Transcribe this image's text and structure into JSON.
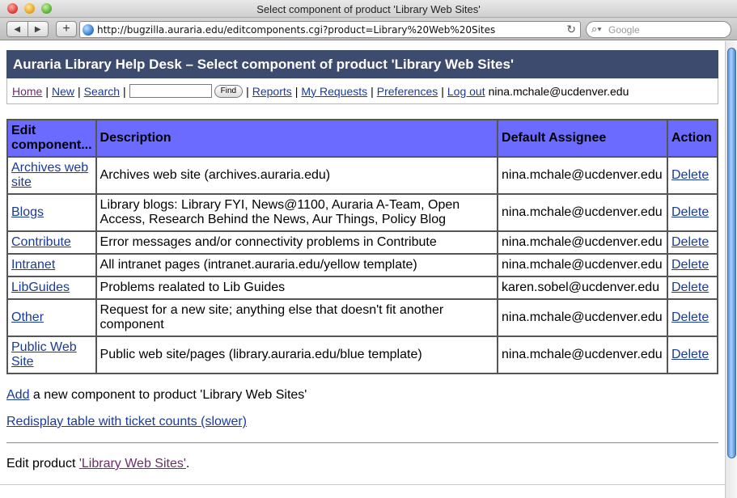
{
  "window": {
    "title": "Select component of product 'Library Web Sites'",
    "back_label": "◀",
    "forward_label": "▶",
    "add_label": "+",
    "url": "http://bugzilla.auraria.edu/editcomponents.cgi?product=Library%20Web%20Sites",
    "reload_glyph": "↻",
    "search_glyph": "⌕▾",
    "search_placeholder": "Google"
  },
  "header": {
    "title": "Auraria Library Help Desk – Select component of product 'Library Web Sites'"
  },
  "nav": {
    "home": "Home",
    "new": "New",
    "search": "Search",
    "find_label": "Find",
    "reports": "Reports",
    "my_requests": "My Requests",
    "preferences": "Preferences",
    "logout": "Log out",
    "user_email": "nina.mchale@ucdenver.edu",
    "separator": "|"
  },
  "table": {
    "headers": {
      "name": "Edit component...",
      "description": "Description",
      "assignee": "Default Assignee",
      "action": "Action"
    },
    "rows": [
      {
        "name": "Archives web site",
        "description": "Archives web site (archives.auraria.edu)",
        "assignee": "nina.mchale@ucdenver.edu",
        "action": "Delete"
      },
      {
        "name": "Blogs",
        "description": "Library blogs: Library FYI, News@1100, Auraria A-Team, Open Access, Research Behind the News, Aur Things, Policy Blog",
        "assignee": "nina.mchale@ucdenver.edu",
        "action": "Delete"
      },
      {
        "name": "Contribute",
        "description": "Error messages and/or connectivity problems in Contribute",
        "assignee": "nina.mchale@ucdenver.edu",
        "action": "Delete"
      },
      {
        "name": "Intranet",
        "description": "All intranet pages (intranet.auraria.edu/yellow template)",
        "assignee": "nina.mchale@ucdenver.edu",
        "action": "Delete"
      },
      {
        "name": "LibGuides",
        "description": "Problems realated to Lib Guides",
        "assignee": "karen.sobel@ucdenver.edu",
        "action": "Delete"
      },
      {
        "name": "Other",
        "description": "Request for a new site; anything else that doesn't fit another component",
        "assignee": "nina.mchale@ucdenver.edu",
        "action": "Delete"
      },
      {
        "name": "Public Web Site",
        "description": "Public web site/pages (library.auraria.edu/blue template)",
        "assignee": "nina.mchale@ucdenver.edu",
        "action": "Delete"
      }
    ]
  },
  "footer": {
    "add_link": "Add",
    "add_text": " a new component to product 'Library Web Sites'",
    "redisplay_link": "Redisplay table with ticket counts (slower)",
    "edit_prefix": "Edit product ",
    "edit_link": "'Library Web Sites'",
    "edit_suffix": "."
  }
}
